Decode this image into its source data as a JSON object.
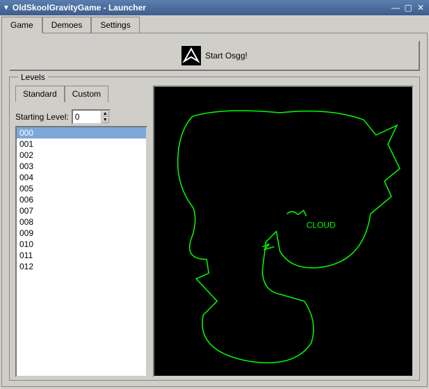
{
  "window": {
    "title": "OldSkoolGravityGame - Launcher"
  },
  "tabs": {
    "items": [
      "Game",
      "Demoes",
      "Settings"
    ],
    "active": 0
  },
  "start_button": {
    "label": "Start Osgg!"
  },
  "levels": {
    "legend": "Levels",
    "subtabs": {
      "items": [
        "Standard",
        "Custom"
      ],
      "active": 0
    },
    "starting_label": "Starting Level:",
    "starting_value": "0",
    "list": [
      "000",
      "001",
      "002",
      "003",
      "004",
      "005",
      "006",
      "007",
      "008",
      "009",
      "010",
      "011",
      "012"
    ],
    "selected_index": 0
  },
  "preview": {
    "annotation": "CLOUD",
    "map_color": "#00ff00"
  }
}
